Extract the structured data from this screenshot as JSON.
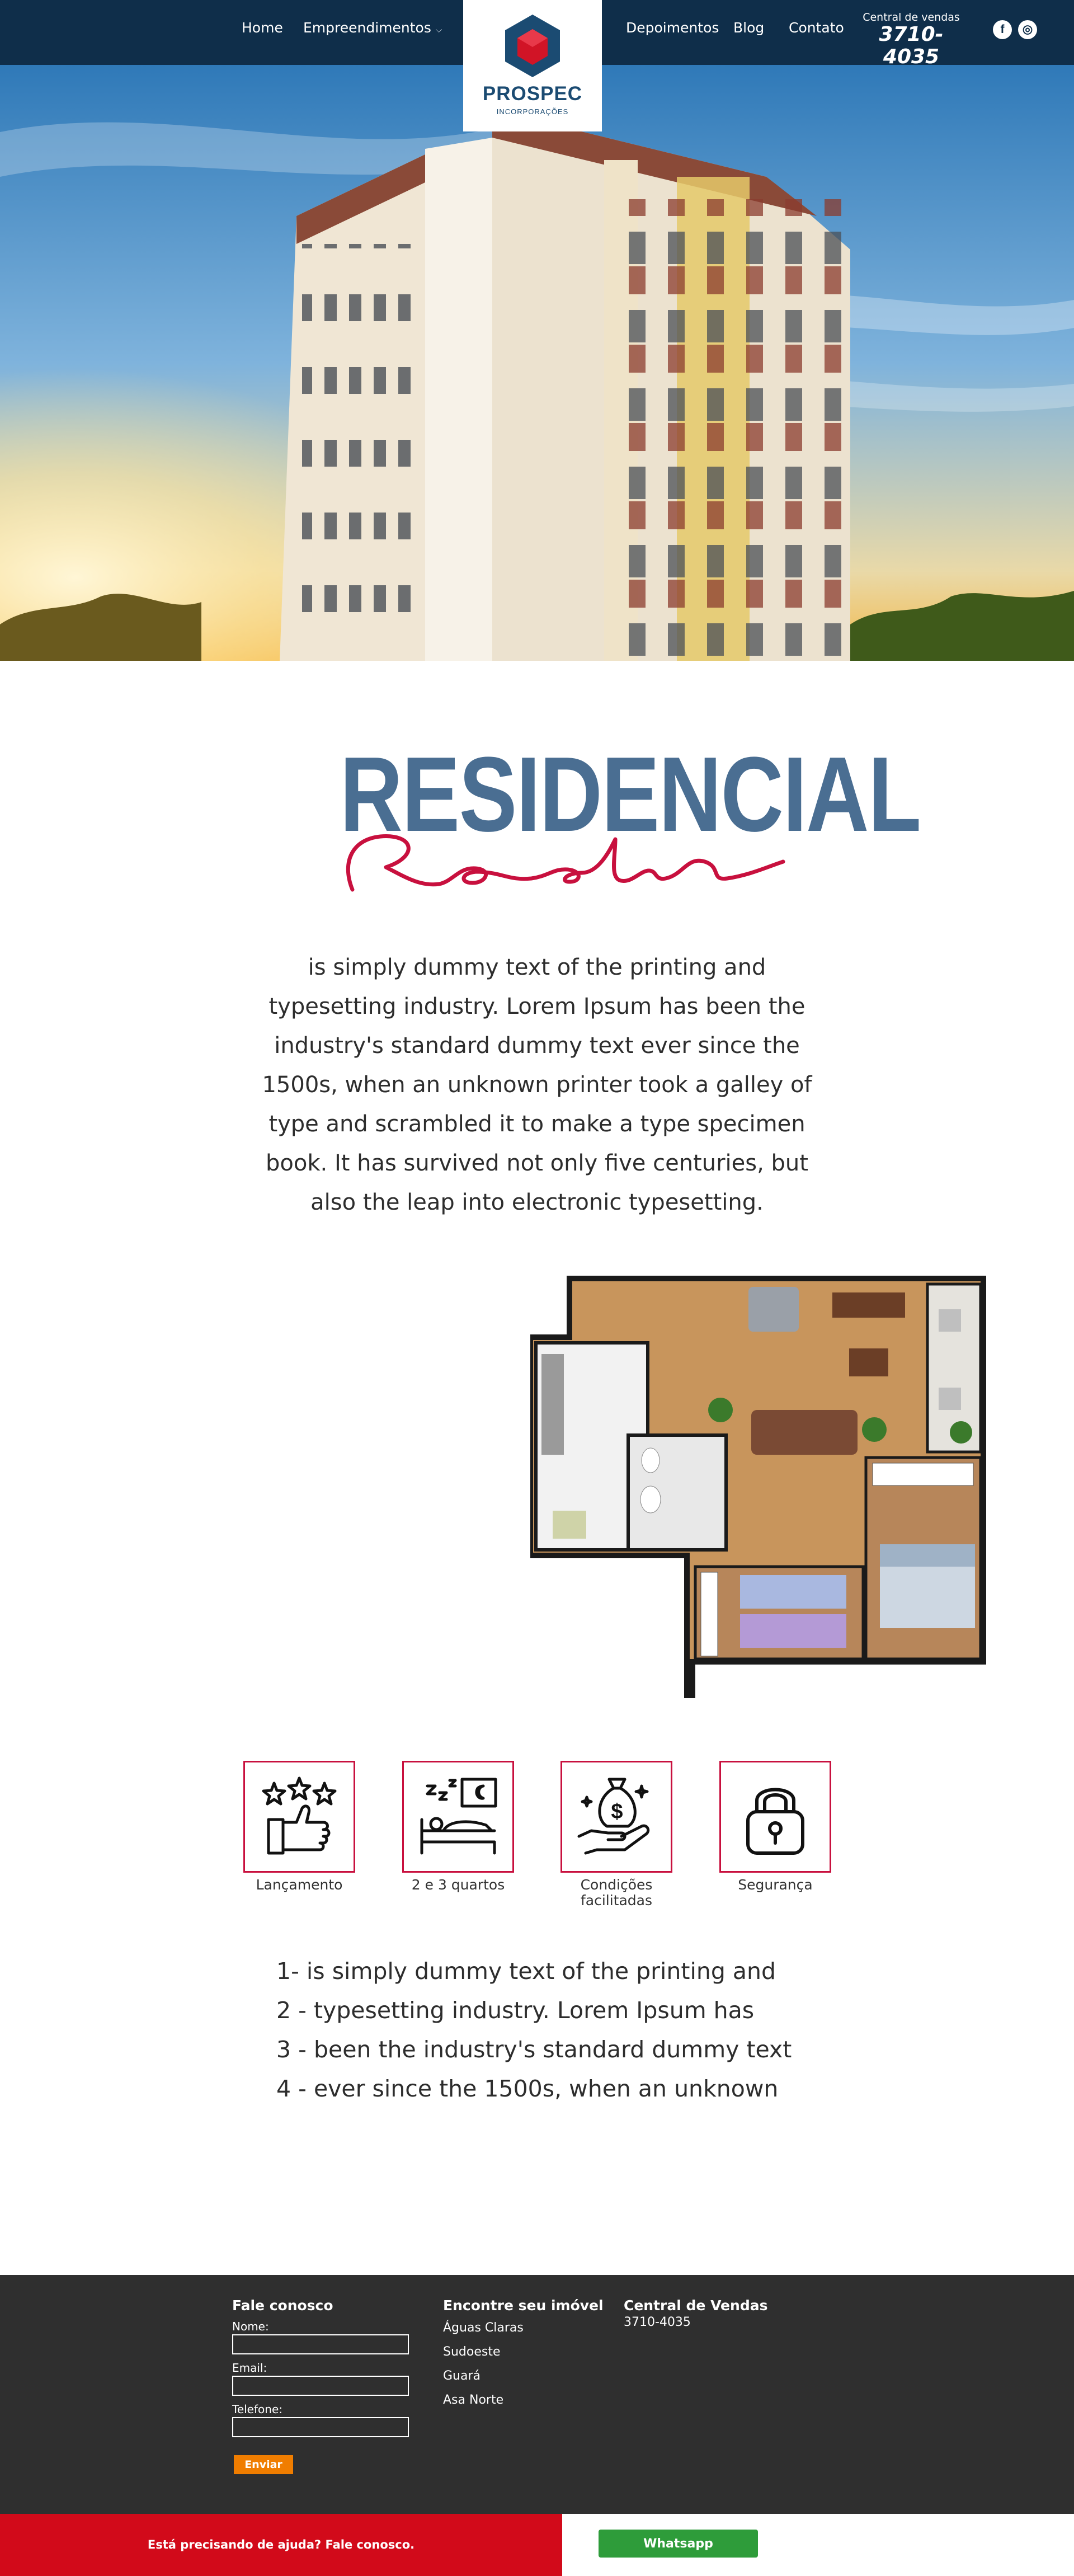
{
  "nav": {
    "home": "Home",
    "empreendimentos": "Empreendimentos",
    "depoimentos": "Depoimentos",
    "blog": "Blog",
    "contato": "Contato",
    "sales_label": "Central de vendas",
    "sales_phone": "3710-4035",
    "facebook_glyph": "f",
    "instagram_glyph": "◎"
  },
  "logo": {
    "name": "PROSPEC",
    "subtitle": "INCORPORAÇÕES"
  },
  "hero": {
    "image": "building-photo"
  },
  "title": {
    "main": "RESIDENCIAL",
    "script": "Rosalie"
  },
  "intro": "is simply dummy text of the printing and typesetting industry. Lorem Ipsum has been the industry's standard dummy text ever since the 1500s, when an unknown printer took a galley of type and scrambled it to make a type specimen book. It has survived not only five centuries, but also the leap into electronic typesetting.",
  "features": [
    {
      "label": "Lançamento",
      "icon": "thumbs-up-stars-icon"
    },
    {
      "label": "2 e 3 quartos",
      "icon": "sleeping-bed-icon"
    },
    {
      "label": "Condições facilitadas",
      "icon": "money-bag-hand-icon"
    },
    {
      "label": "Segurança",
      "icon": "padlock-icon"
    }
  ],
  "list": [
    "1- is simply dummy text of the printing and",
    "2 - typesetting industry. Lorem Ipsum has",
    "3 - been the industry's standard dummy text",
    "4 - ever since the 1500s, when an unknown"
  ],
  "footer": {
    "contact_title": "Fale conosco",
    "name_label": "Nome:",
    "email_label": "Email:",
    "phone_label": "Telefone:",
    "send_label": "Enviar",
    "find_title": "Encontre seu imóvel",
    "locations": [
      "Águas Claras",
      "Sudoeste",
      "Guará",
      "Asa Norte"
    ],
    "sales_title": "Central de Vendas",
    "sales_phone": "3710-4035"
  },
  "bottom": {
    "help_text": "Está precisando de ajuda? Fale conosco.",
    "whatsapp_label": "Whatsapp"
  },
  "colors": {
    "nav_bg": "#0f2e4a",
    "title_blue": "#4a6e92",
    "accent_red": "#c8103e",
    "footer_bg": "#2f2f2f",
    "send_orange": "#f07d00",
    "whatsapp_green": "#2e9c3a",
    "help_red": "#d20a1a"
  }
}
